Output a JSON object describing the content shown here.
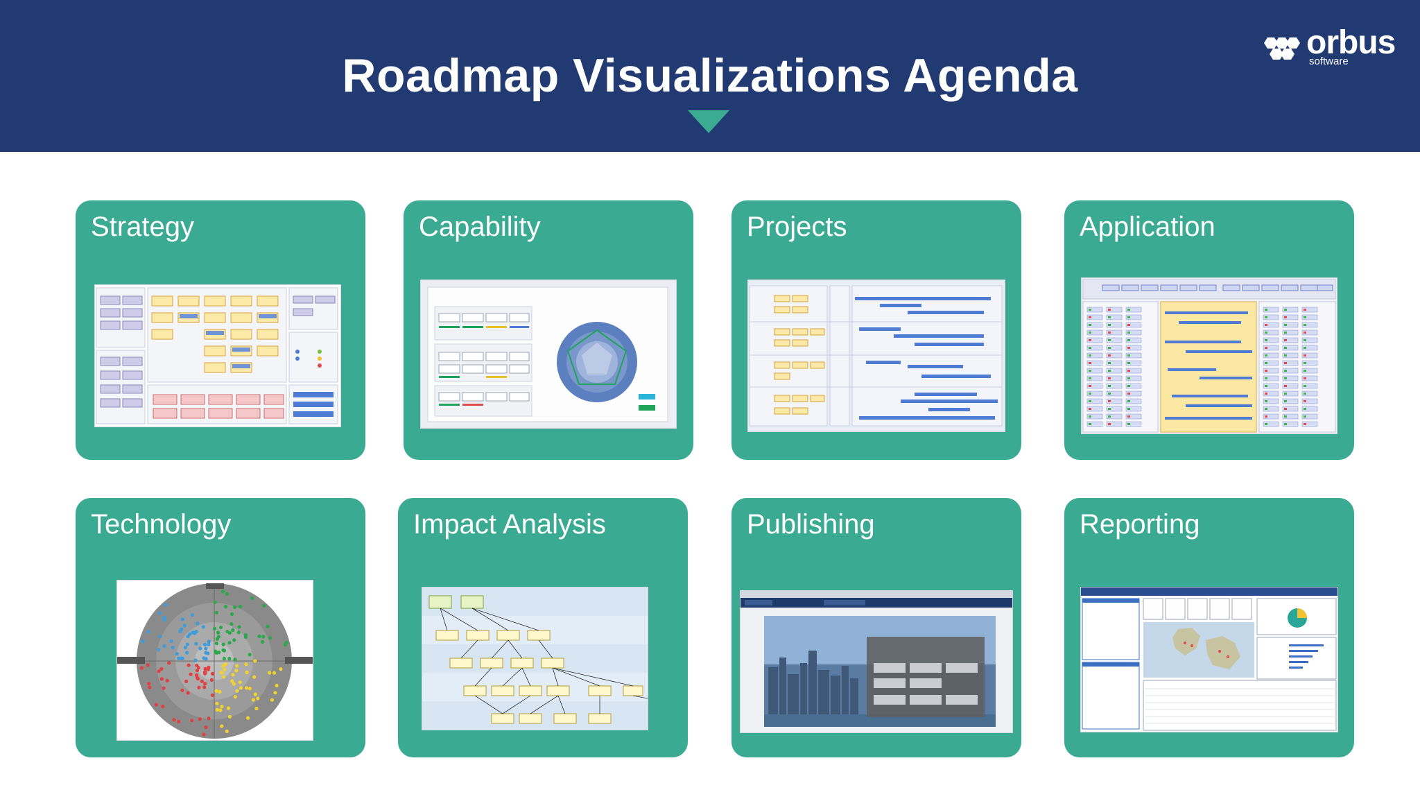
{
  "slide": {
    "title": "Roadmap Visualizations Agenda",
    "logo_text": "orbus",
    "logo_subtext": "software"
  },
  "colors": {
    "header_bg": "#223a72",
    "card_bg": "#3aab92",
    "accent_triangle": "#3bac92"
  },
  "cards": [
    {
      "label": "Strategy",
      "thumbnail": "strategy-diagram"
    },
    {
      "label": "Capability",
      "thumbnail": "capability-radar-diagram"
    },
    {
      "label": "Projects",
      "thumbnail": "projects-gantt-roadmap"
    },
    {
      "label": "Application",
      "thumbnail": "application-roadmap"
    },
    {
      "label": "Technology",
      "thumbnail": "technology-radar"
    },
    {
      "label": "Impact Analysis",
      "thumbnail": "impact-analysis-layered-diagram"
    },
    {
      "label": "Publishing",
      "thumbnail": "publishing-portal-screenshot"
    },
    {
      "label": "Reporting",
      "thumbnail": "reporting-dashboard"
    }
  ]
}
